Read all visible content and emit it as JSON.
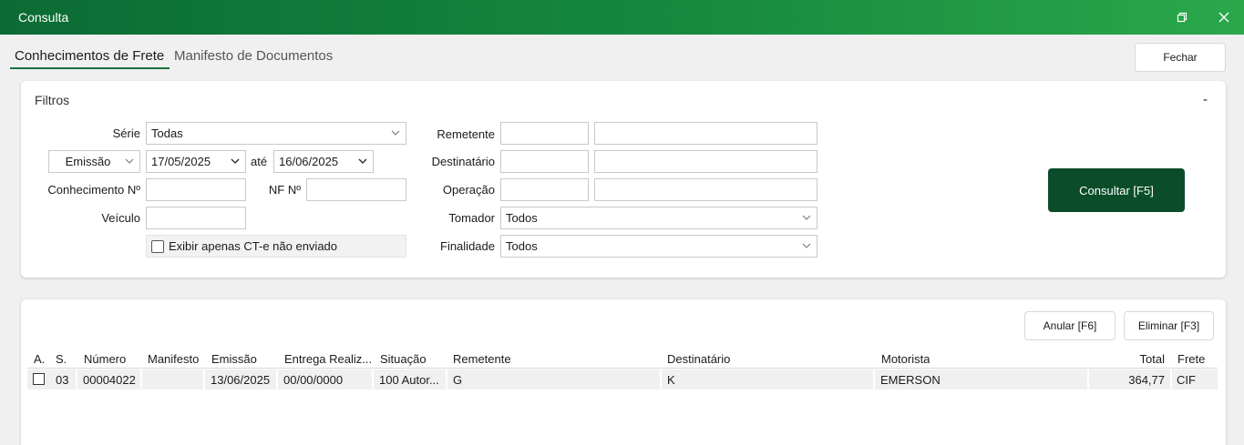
{
  "window": {
    "title": "Consulta"
  },
  "tabs": [
    {
      "label": "Conhecimentos de Frete",
      "active": true
    },
    {
      "label": "Manifesto de Documentos",
      "active": false
    }
  ],
  "close_button": "Fechar",
  "filters": {
    "title": "Filtros",
    "collapse_symbol": "-",
    "serie_label": "Série",
    "serie_value": "Todas",
    "date_type_value": "Emissão",
    "date_from": "17/05/2025",
    "ate_label": "até",
    "date_to": "16/06/2025",
    "conhecimento_label": "Conhecimento Nº",
    "conhecimento_value": "",
    "nf_label": "NF Nº",
    "nf_value": "",
    "veiculo_label": "Veículo",
    "veiculo_value": "",
    "only_not_sent_label": "Exibir apenas CT-e não enviado",
    "remetente_label": "Remetente",
    "destinatario_label": "Destinatário",
    "operacao_label": "Operação",
    "tomador_label": "Tomador",
    "tomador_value": "Todos",
    "finalidade_label": "Finalidade",
    "finalidade_value": "Todos",
    "consultar_button": "Consultar [F5]"
  },
  "actions": {
    "anular_button": "Anular [F6]",
    "eliminar_button": "Eliminar [F3]"
  },
  "table": {
    "columns": [
      "A.",
      "S.",
      "Número",
      "Manifesto",
      "Emissão",
      "Entrega Realiz...",
      "Situação",
      "Remetente",
      "Destinatário",
      "Motorista",
      "Total",
      "Frete"
    ],
    "rows": [
      [
        "",
        "03",
        "00004022",
        "",
        "13/06/2025",
        "00/00/0000",
        "100 Autor...",
        "G",
        "K",
        "EMERSON",
        "364,77",
        "CIF"
      ]
    ]
  },
  "colors": {
    "title_gradient_start": "#0b6b34",
    "title_gradient_end": "#2aa84a",
    "primary_button": "#0b4d2b"
  }
}
